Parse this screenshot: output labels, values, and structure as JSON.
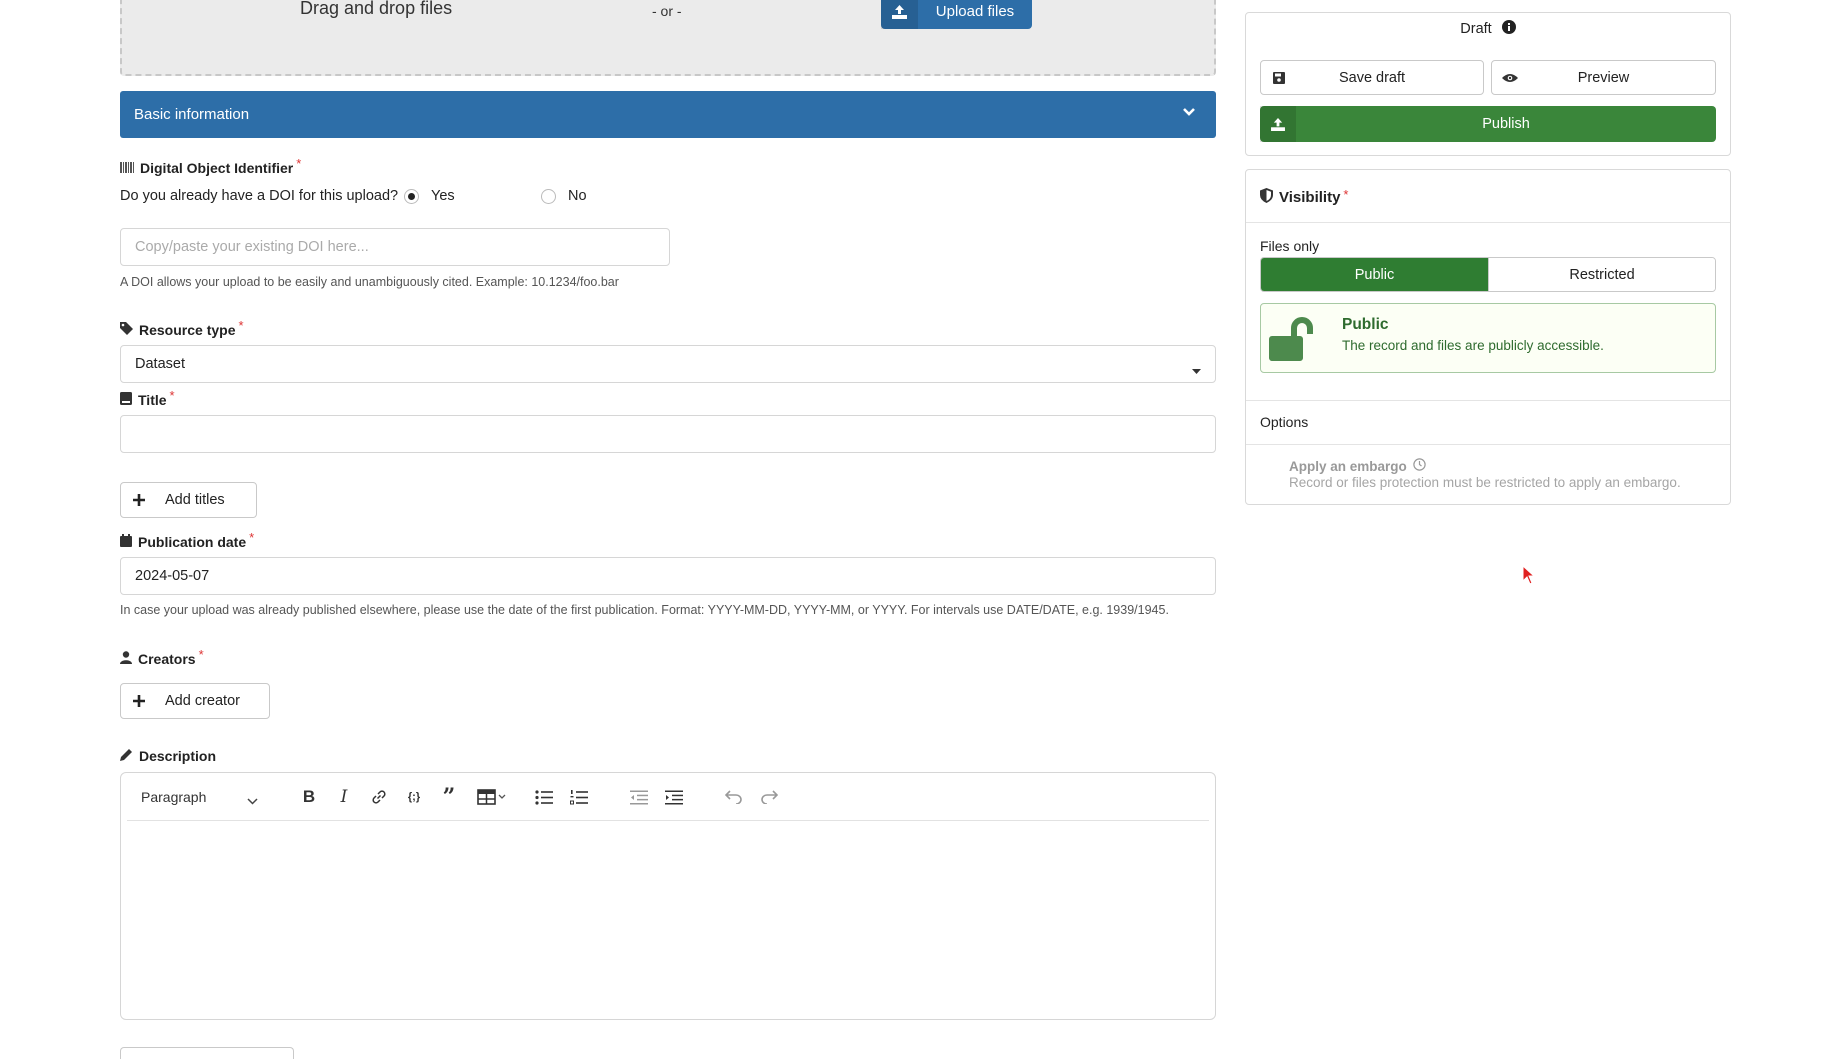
{
  "upload": {
    "drag_text": "Drag and drop files",
    "or_text": "- or -",
    "upload_button": "Upload files"
  },
  "accordion": {
    "title": "Basic information"
  },
  "doi": {
    "label": "Digital Object Identifier",
    "required_mark": "*",
    "question": "Do you already have a DOI for this upload?",
    "option_yes": "Yes",
    "option_no": "No",
    "selected": "Yes",
    "placeholder": "Copy/paste your existing DOI here...",
    "help": "A DOI allows your upload to be easily and unambiguously cited. Example: 10.1234/foo.bar"
  },
  "resource_type": {
    "label": "Resource type",
    "required_mark": "*",
    "value": "Dataset"
  },
  "title_field": {
    "label": "Title",
    "required_mark": "*",
    "value": "",
    "add_button": "Add titles"
  },
  "publication_date": {
    "label": "Publication date",
    "required_mark": "*",
    "value": "2024-05-07",
    "help": "In case your upload was already published elsewhere, please use the date of the first publication. Format: YYYY-MM-DD, YYYY-MM, or YYYY. For intervals use DATE/DATE, e.g. 1939/1945."
  },
  "creators": {
    "label": "Creators",
    "required_mark": "*",
    "add_button": "Add creator"
  },
  "description": {
    "label": "Description",
    "paragraph_style": "Paragraph",
    "toolbar_icons": [
      "bold-icon",
      "italic-icon",
      "link-icon",
      "code-block-icon",
      "blockquote-icon",
      "table-icon",
      "bulleted-list-icon",
      "numbered-list-icon",
      "outdent-icon",
      "indent-icon",
      "undo-icon",
      "redo-icon"
    ]
  },
  "status_panel": {
    "status": "Draft",
    "save_draft": "Save draft",
    "preview": "Preview",
    "publish": "Publish"
  },
  "visibility": {
    "title": "Visibility",
    "required_mark": "*",
    "files_label": "Files only",
    "option_public": "Public",
    "option_restricted": "Restricted",
    "selected": "Public",
    "info_title": "Public",
    "info_text": "The record and files are publicly accessible.",
    "options_header": "Options",
    "embargo_title": "Apply an embargo",
    "embargo_help": "Record or files protection must be restricted to apply an embargo."
  },
  "colors": {
    "primary_blue": "#2d6ea8",
    "publish_green": "#3a863a",
    "public_green": "#2f7d32",
    "public_info_text": "#2e6b2e",
    "required_red": "#d33333",
    "cursor_red": "#e02020"
  }
}
